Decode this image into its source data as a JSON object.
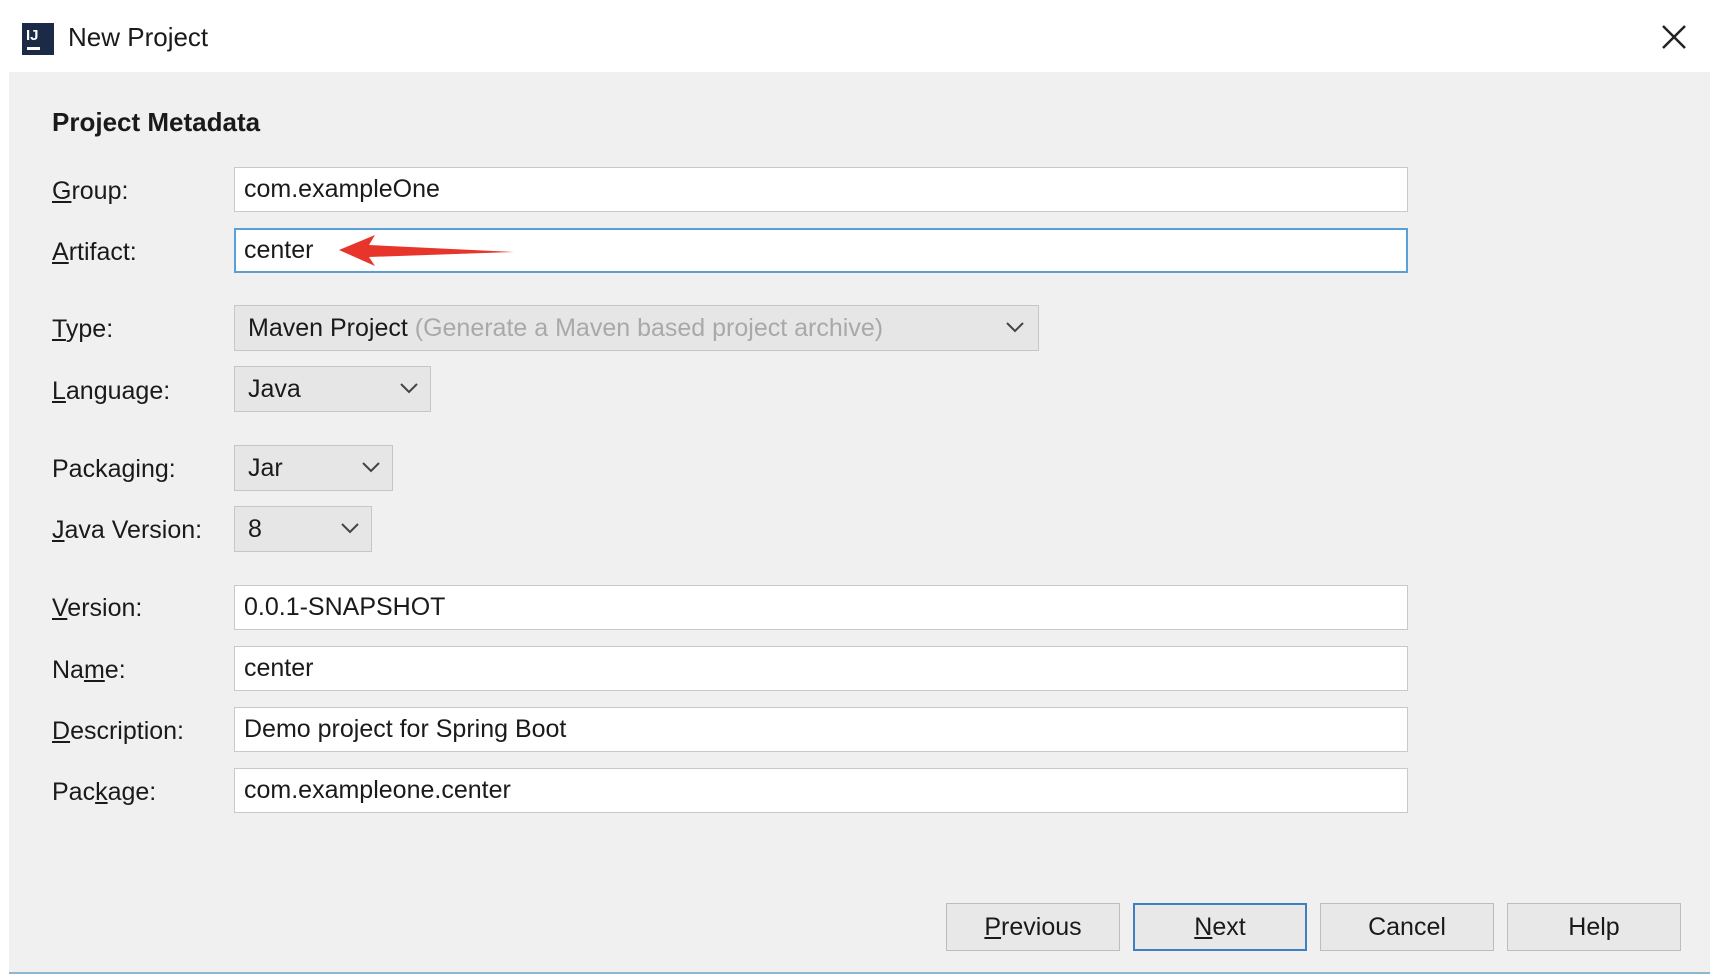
{
  "window": {
    "title": "New Project"
  },
  "section_title": "Project Metadata",
  "fields": {
    "group": {
      "label_pre": "",
      "label_key": "G",
      "label_post": "roup:",
      "value": "com.exampleOne"
    },
    "artifact": {
      "label_pre": "",
      "label_key": "A",
      "label_post": "rtifact:",
      "value": "center"
    },
    "type": {
      "label_pre": "",
      "label_key": "T",
      "label_post": "ype:",
      "value": "Maven Project",
      "hint": "(Generate a Maven based project archive)"
    },
    "language": {
      "label_pre": "",
      "label_key": "L",
      "label_post": "anguage:",
      "value": "Java"
    },
    "packaging": {
      "label_pre": "Packa",
      "label_key": "g",
      "label_post": "ing:",
      "value": "Jar"
    },
    "java_version": {
      "label_pre": "",
      "label_key": "J",
      "label_post": "ava Version:",
      "value": "8"
    },
    "version": {
      "label_pre": "",
      "label_key": "V",
      "label_post": "ersion:",
      "value": "0.0.1-SNAPSHOT"
    },
    "name": {
      "label_pre": "Na",
      "label_key": "m",
      "label_post": "e:",
      "value": "center"
    },
    "description": {
      "label_pre": "",
      "label_key": "D",
      "label_post": "escription:",
      "value": "Demo project for Spring Boot"
    },
    "package": {
      "label_pre": "Pac",
      "label_key": "k",
      "label_post": "age:",
      "value": "com.exampleone.center"
    }
  },
  "buttons": {
    "previous": {
      "key": "P",
      "rest": "revious"
    },
    "next": {
      "key": "N",
      "rest": "ext"
    },
    "cancel": "Cancel",
    "help": "Help"
  },
  "icons": {
    "app": "intellij-idea-icon",
    "close": "close-icon",
    "chevron": "chevron-down-icon",
    "annotation": "red-arrow-annotation"
  },
  "colors": {
    "focus_border": "#5aa0d8",
    "default_button_border": "#3d7fc2",
    "annotation_arrow": "#e8352b"
  }
}
